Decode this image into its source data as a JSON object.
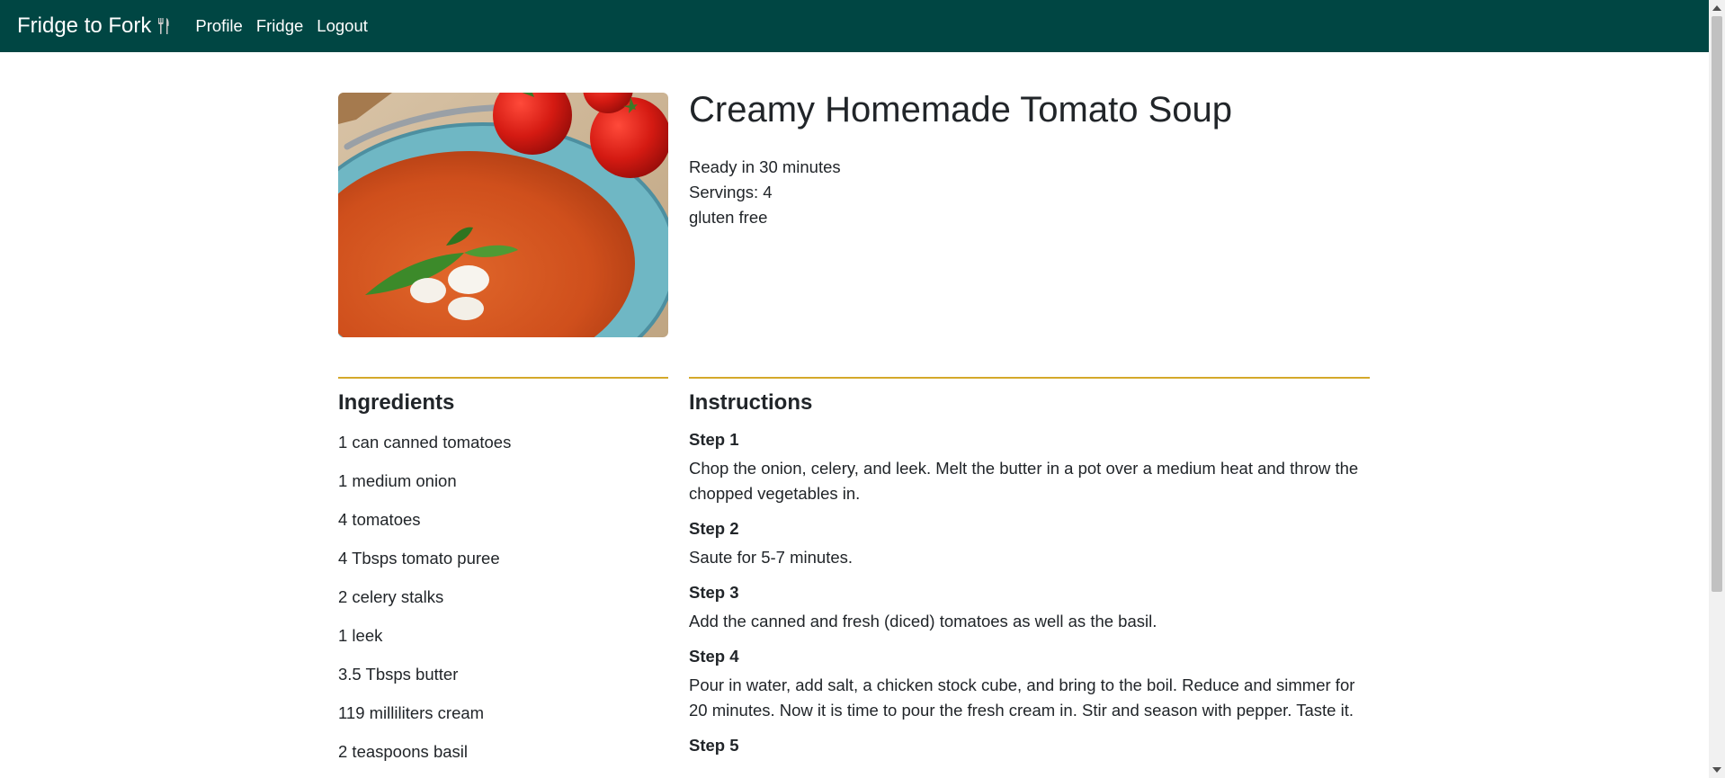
{
  "nav": {
    "brand": "Fridge to Fork",
    "links": [
      "Profile",
      "Fridge",
      "Logout"
    ]
  },
  "recipe": {
    "title": "Creamy Homemade Tomato Soup",
    "ready": "Ready in 30 minutes",
    "servings": "Servings: 4",
    "diet": "gluten free"
  },
  "ingredients": {
    "title": "Ingredients",
    "items": [
      "1 can canned tomatoes",
      "1 medium onion",
      "4 tomatoes",
      "4 Tbsps tomato puree",
      "2 celery stalks",
      "1 leek",
      "3.5 Tbsps butter",
      "119 milliliters cream",
      "2 teaspoons basil"
    ]
  },
  "instructions": {
    "title": "Instructions",
    "steps": [
      {
        "label": "Step 1",
        "text": "Chop the onion, celery, and leek. Melt the butter in a pot over a medium heat and throw the chopped vegetables in."
      },
      {
        "label": "Step 2",
        "text": "Saute for 5-7 minutes."
      },
      {
        "label": "Step 3",
        "text": "Add the canned and fresh (diced) tomatoes as well as the basil."
      },
      {
        "label": "Step 4",
        "text": "Pour in water, add salt, a chicken stock cube, and bring to the boil. Reduce and simmer for 20 minutes. Now it is time to pour the fresh cream in. Stir and season with pepper. Taste it."
      },
      {
        "label": "Step 5",
        "text": ""
      }
    ]
  },
  "colors": {
    "navbar": "#004643",
    "accent_rule": "#d4a92a"
  },
  "icons": {
    "brand": "fork-knife-icon",
    "image": "tomato-soup-photo"
  }
}
